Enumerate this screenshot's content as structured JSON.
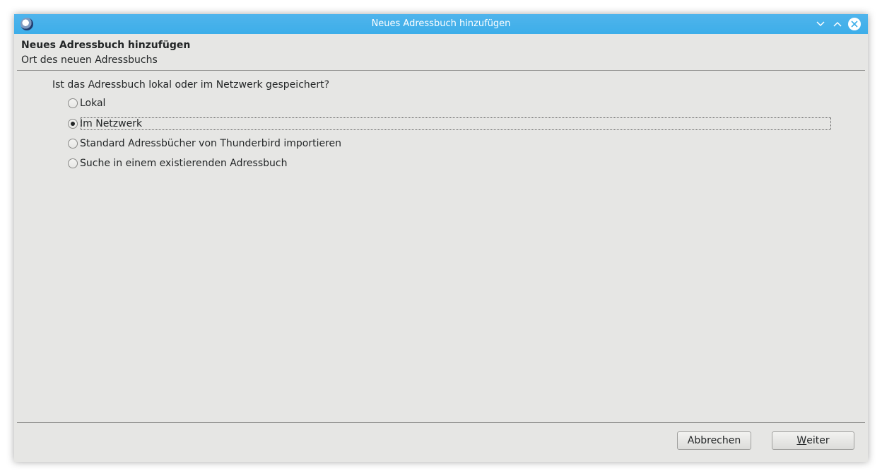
{
  "window": {
    "title": "Neues Adressbuch hinzufügen",
    "app_icon": "thunderbird-icon",
    "titlebar_color": "#3daee9"
  },
  "header": {
    "title": "Neues Adressbuch hinzufügen",
    "subtitle": "Ort des neuen Adressbuchs"
  },
  "question": "Ist das Adressbuch lokal oder im Netzwerk gespeichert?",
  "options": [
    {
      "label": "Lokal",
      "checked": false
    },
    {
      "label": "Im Netzwerk",
      "checked": true
    },
    {
      "label": "Standard Adressbücher von Thunderbird importieren",
      "checked": false
    },
    {
      "label": "Suche in einem existierenden Adressbuch",
      "checked": false
    }
  ],
  "buttons": {
    "cancel": "Abbrechen",
    "next_mnemonic": "W",
    "next_rest": "eiter"
  }
}
